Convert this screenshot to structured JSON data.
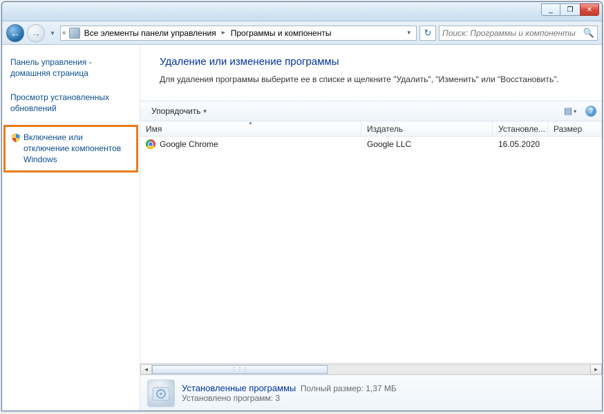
{
  "titlebar": {
    "minimize_label": "_",
    "maximize_label": "❐",
    "close_label": "✕"
  },
  "nav": {
    "back_glyph": "←",
    "fwd_glyph": "→",
    "history_glyph": "▼",
    "dbl_chevron": "«",
    "crumb1": "Все элементы панели управления",
    "crumb2": "Программы и компоненты",
    "sep": "▸",
    "drop_glyph": "▾",
    "refresh_glyph": "↻"
  },
  "search": {
    "placeholder": "Поиск: Программы и компоненты",
    "icon": "🔍"
  },
  "sidebar": {
    "home": "Панель управления - домашняя страница",
    "updates": "Просмотр установленных обновлений",
    "features": "Включение или отключение компонентов Windows"
  },
  "main": {
    "heading": "Удаление или изменение программы",
    "subtext": "Для удаления программы выберите ее в списке и щелкните \"Удалить\", \"Изменить\" или \"Восстановить\"."
  },
  "toolbar": {
    "organize": "Упорядочить",
    "drop": "▾",
    "view_glyph": "▤",
    "help_glyph": "?"
  },
  "columns": {
    "name": "Имя",
    "publisher": "Издатель",
    "installed": "Установле...",
    "size": "Размер"
  },
  "rows": [
    {
      "name": "Google Chrome",
      "publisher": "Google LLC",
      "date": "16.05.2020"
    }
  ],
  "details": {
    "title": "Установленные программы",
    "size_label": "Полный размер:",
    "size_value": "1,37 МБ",
    "count_label": "Установлено программ:",
    "count_value": "3"
  },
  "hscroll": {
    "left": "◄",
    "right": "►",
    "grip": "⋮⋮⋮"
  }
}
